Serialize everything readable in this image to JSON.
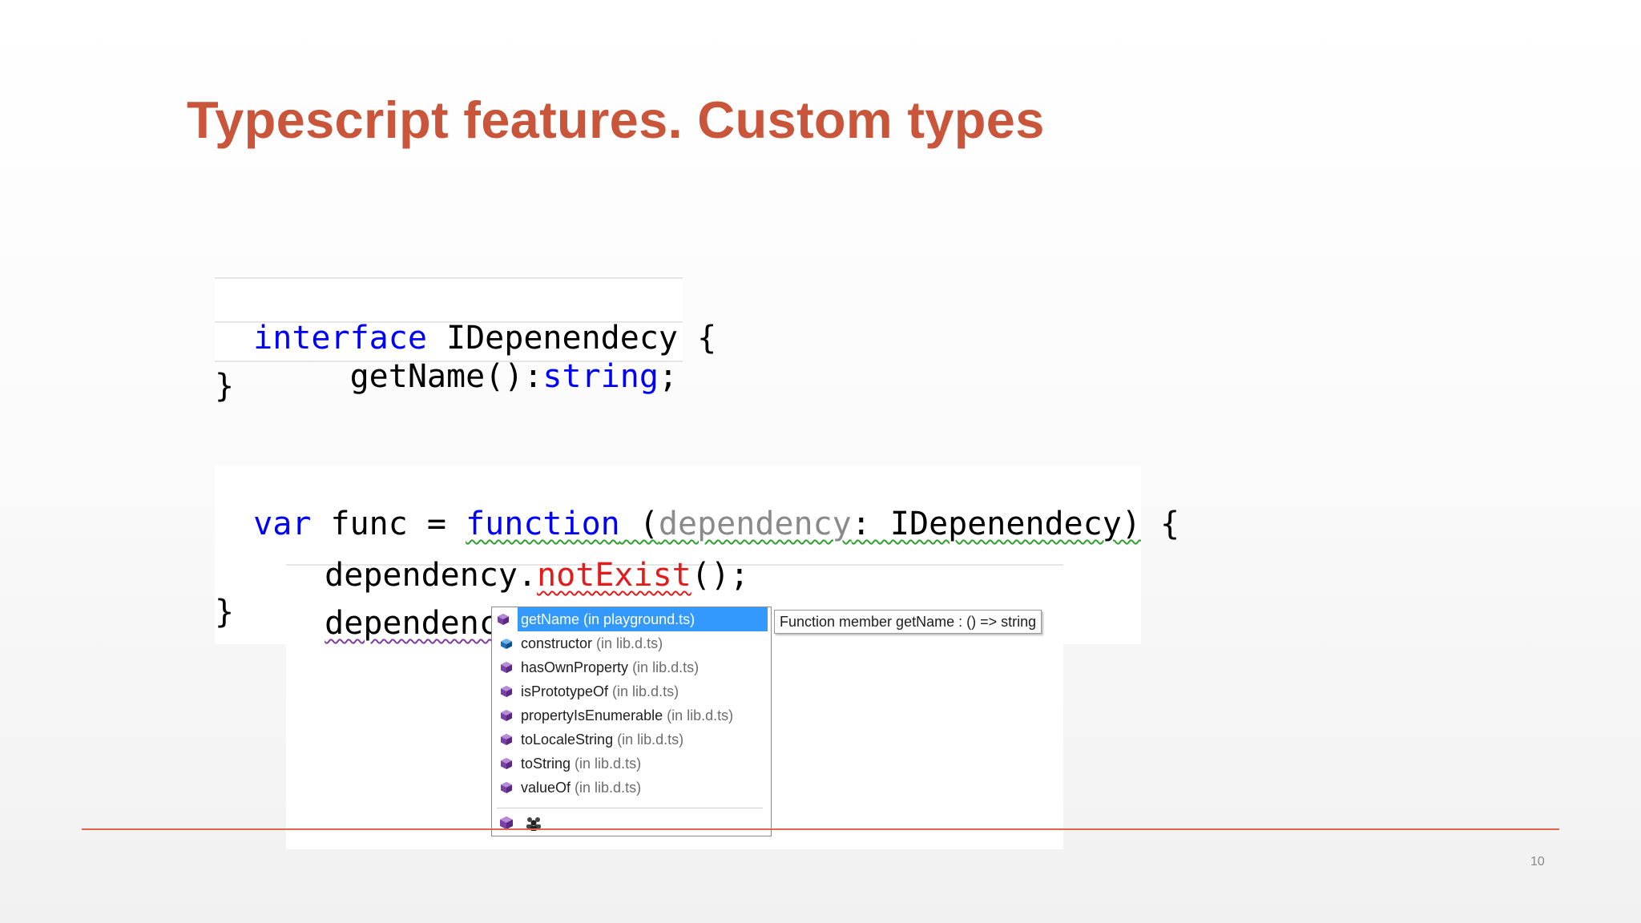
{
  "slide": {
    "title": "Typescript features. Custom types",
    "page_number": "10"
  },
  "code": {
    "interface_kw": "interface",
    "interface_name": " IDepenendecy {",
    "method_indent": "     ",
    "method_name": "getName():",
    "string_kw": "string",
    "method_end": ";",
    "close_brace": "}",
    "var_kw": "var",
    "func_assign": " func = ",
    "function_kw": "function",
    "open_paren": " (",
    "param_name": "dependency",
    "param_type": ": IDepenendecy)",
    "open_brace": " {",
    "call_obj": "dependency.",
    "call_error": "notExist",
    "call_end": "();",
    "dot_access": "dependency.",
    "close_brace_2": "}"
  },
  "completion": {
    "items": [
      {
        "name": "getName",
        "location": "(in playground.ts)",
        "icon": "method-cube-icon",
        "selected": true
      },
      {
        "name": "constructor",
        "location": "(in lib.d.ts)",
        "icon": "constructor-cube-icon"
      },
      {
        "name": "hasOwnProperty",
        "location": "(in lib.d.ts)",
        "icon": "method-cube-icon"
      },
      {
        "name": "isPrototypeOf",
        "location": "(in lib.d.ts)",
        "icon": "method-cube-icon"
      },
      {
        "name": "propertyIsEnumerable",
        "location": "(in lib.d.ts)",
        "icon": "method-cube-icon"
      },
      {
        "name": "toLocaleString",
        "location": "(in lib.d.ts)",
        "icon": "method-cube-icon"
      },
      {
        "name": "toString",
        "location": "(in lib.d.ts)",
        "icon": "method-cube-icon"
      },
      {
        "name": "valueOf",
        "location": "(in lib.d.ts)",
        "icon": "method-cube-icon"
      }
    ],
    "filters": [
      "method-filter-icon",
      "group-filter-icon"
    ],
    "tooltip": "Function member getName : () => string"
  },
  "colors": {
    "title": "#c9553a",
    "keyword": "#0000ff",
    "error": "#e31b1b",
    "selection": "#3399ff",
    "method_icon": "#7b3fa6"
  }
}
